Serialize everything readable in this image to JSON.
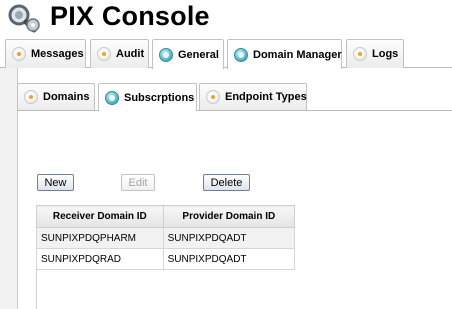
{
  "app": {
    "title": "PIX Console",
    "logo_icon": "magnifier-gear-icon"
  },
  "main_tabs": [
    {
      "label": "Messages",
      "icon": "plain-dot-icon",
      "active": false
    },
    {
      "label": "Audit",
      "icon": "plain-dot-icon",
      "active": false
    },
    {
      "label": "General",
      "icon": "active-dot-icon",
      "active": true
    },
    {
      "label": "Domain Manager",
      "icon": "active-dot-icon",
      "active": true
    },
    {
      "label": "Logs",
      "icon": "plain-dot-icon",
      "active": false
    }
  ],
  "sub_tabs": [
    {
      "label": "Domains",
      "icon": "plain-dot-icon",
      "active": false
    },
    {
      "label": "Subscrptions",
      "icon": "active-dot-icon",
      "active": true
    },
    {
      "label": "Endpoint Types",
      "icon": "plain-dot-icon",
      "active": false
    }
  ],
  "toolbar": {
    "new_label": "New",
    "edit_label": "Edit",
    "delete_label": "Delete"
  },
  "table": {
    "headers": [
      "Receiver Domain ID",
      "Provider Domain ID"
    ],
    "rows": [
      [
        "SUNPIXPDQPHARM",
        "SUNPIXPDQADT"
      ],
      [
        "SUNPIXPDQRAD",
        "SUNPIXPDQADT"
      ]
    ]
  },
  "colors": {
    "active_tab_icon": "#5fbfd0",
    "inactive_tab_icon_dot": "#e9a52a",
    "button_border": "#6e7f99"
  }
}
